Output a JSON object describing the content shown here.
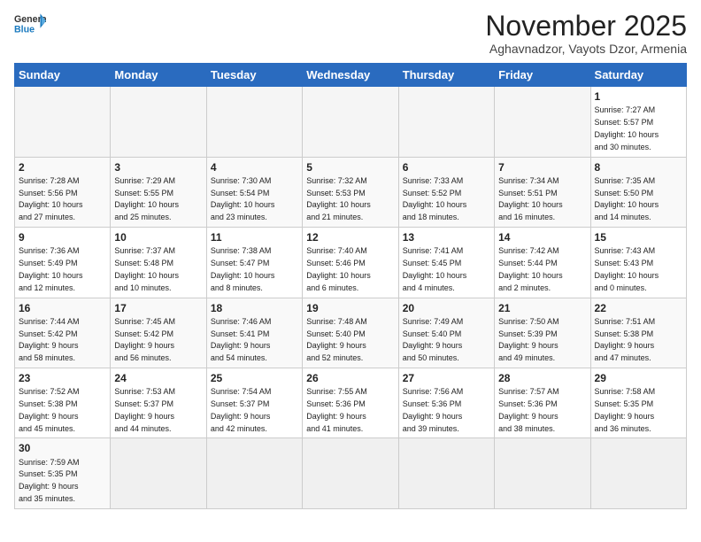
{
  "header": {
    "logo_general": "General",
    "logo_blue": "Blue",
    "month_title": "November 2025",
    "location": "Aghavnadzor, Vayots Dzor, Armenia"
  },
  "weekdays": [
    "Sunday",
    "Monday",
    "Tuesday",
    "Wednesday",
    "Thursday",
    "Friday",
    "Saturday"
  ],
  "weeks": [
    [
      {
        "day": "",
        "info": ""
      },
      {
        "day": "",
        "info": ""
      },
      {
        "day": "",
        "info": ""
      },
      {
        "day": "",
        "info": ""
      },
      {
        "day": "",
        "info": ""
      },
      {
        "day": "",
        "info": ""
      },
      {
        "day": "1",
        "info": "Sunrise: 7:27 AM\nSunset: 5:57 PM\nDaylight: 10 hours\nand 30 minutes."
      }
    ],
    [
      {
        "day": "2",
        "info": "Sunrise: 7:28 AM\nSunset: 5:56 PM\nDaylight: 10 hours\nand 27 minutes."
      },
      {
        "day": "3",
        "info": "Sunrise: 7:29 AM\nSunset: 5:55 PM\nDaylight: 10 hours\nand 25 minutes."
      },
      {
        "day": "4",
        "info": "Sunrise: 7:30 AM\nSunset: 5:54 PM\nDaylight: 10 hours\nand 23 minutes."
      },
      {
        "day": "5",
        "info": "Sunrise: 7:32 AM\nSunset: 5:53 PM\nDaylight: 10 hours\nand 21 minutes."
      },
      {
        "day": "6",
        "info": "Sunrise: 7:33 AM\nSunset: 5:52 PM\nDaylight: 10 hours\nand 18 minutes."
      },
      {
        "day": "7",
        "info": "Sunrise: 7:34 AM\nSunset: 5:51 PM\nDaylight: 10 hours\nand 16 minutes."
      },
      {
        "day": "8",
        "info": "Sunrise: 7:35 AM\nSunset: 5:50 PM\nDaylight: 10 hours\nand 14 minutes."
      }
    ],
    [
      {
        "day": "9",
        "info": "Sunrise: 7:36 AM\nSunset: 5:49 PM\nDaylight: 10 hours\nand 12 minutes."
      },
      {
        "day": "10",
        "info": "Sunrise: 7:37 AM\nSunset: 5:48 PM\nDaylight: 10 hours\nand 10 minutes."
      },
      {
        "day": "11",
        "info": "Sunrise: 7:38 AM\nSunset: 5:47 PM\nDaylight: 10 hours\nand 8 minutes."
      },
      {
        "day": "12",
        "info": "Sunrise: 7:40 AM\nSunset: 5:46 PM\nDaylight: 10 hours\nand 6 minutes."
      },
      {
        "day": "13",
        "info": "Sunrise: 7:41 AM\nSunset: 5:45 PM\nDaylight: 10 hours\nand 4 minutes."
      },
      {
        "day": "14",
        "info": "Sunrise: 7:42 AM\nSunset: 5:44 PM\nDaylight: 10 hours\nand 2 minutes."
      },
      {
        "day": "15",
        "info": "Sunrise: 7:43 AM\nSunset: 5:43 PM\nDaylight: 10 hours\nand 0 minutes."
      }
    ],
    [
      {
        "day": "16",
        "info": "Sunrise: 7:44 AM\nSunset: 5:42 PM\nDaylight: 9 hours\nand 58 minutes."
      },
      {
        "day": "17",
        "info": "Sunrise: 7:45 AM\nSunset: 5:42 PM\nDaylight: 9 hours\nand 56 minutes."
      },
      {
        "day": "18",
        "info": "Sunrise: 7:46 AM\nSunset: 5:41 PM\nDaylight: 9 hours\nand 54 minutes."
      },
      {
        "day": "19",
        "info": "Sunrise: 7:48 AM\nSunset: 5:40 PM\nDaylight: 9 hours\nand 52 minutes."
      },
      {
        "day": "20",
        "info": "Sunrise: 7:49 AM\nSunset: 5:40 PM\nDaylight: 9 hours\nand 50 minutes."
      },
      {
        "day": "21",
        "info": "Sunrise: 7:50 AM\nSunset: 5:39 PM\nDaylight: 9 hours\nand 49 minutes."
      },
      {
        "day": "22",
        "info": "Sunrise: 7:51 AM\nSunset: 5:38 PM\nDaylight: 9 hours\nand 47 minutes."
      }
    ],
    [
      {
        "day": "23",
        "info": "Sunrise: 7:52 AM\nSunset: 5:38 PM\nDaylight: 9 hours\nand 45 minutes."
      },
      {
        "day": "24",
        "info": "Sunrise: 7:53 AM\nSunset: 5:37 PM\nDaylight: 9 hours\nand 44 minutes."
      },
      {
        "day": "25",
        "info": "Sunrise: 7:54 AM\nSunset: 5:37 PM\nDaylight: 9 hours\nand 42 minutes."
      },
      {
        "day": "26",
        "info": "Sunrise: 7:55 AM\nSunset: 5:36 PM\nDaylight: 9 hours\nand 41 minutes."
      },
      {
        "day": "27",
        "info": "Sunrise: 7:56 AM\nSunset: 5:36 PM\nDaylight: 9 hours\nand 39 minutes."
      },
      {
        "day": "28",
        "info": "Sunrise: 7:57 AM\nSunset: 5:36 PM\nDaylight: 9 hours\nand 38 minutes."
      },
      {
        "day": "29",
        "info": "Sunrise: 7:58 AM\nSunset: 5:35 PM\nDaylight: 9 hours\nand 36 minutes."
      }
    ],
    [
      {
        "day": "30",
        "info": "Sunrise: 7:59 AM\nSunset: 5:35 PM\nDaylight: 9 hours\nand 35 minutes."
      },
      {
        "day": "",
        "info": ""
      },
      {
        "day": "",
        "info": ""
      },
      {
        "day": "",
        "info": ""
      },
      {
        "day": "",
        "info": ""
      },
      {
        "day": "",
        "info": ""
      },
      {
        "day": "",
        "info": ""
      }
    ]
  ]
}
